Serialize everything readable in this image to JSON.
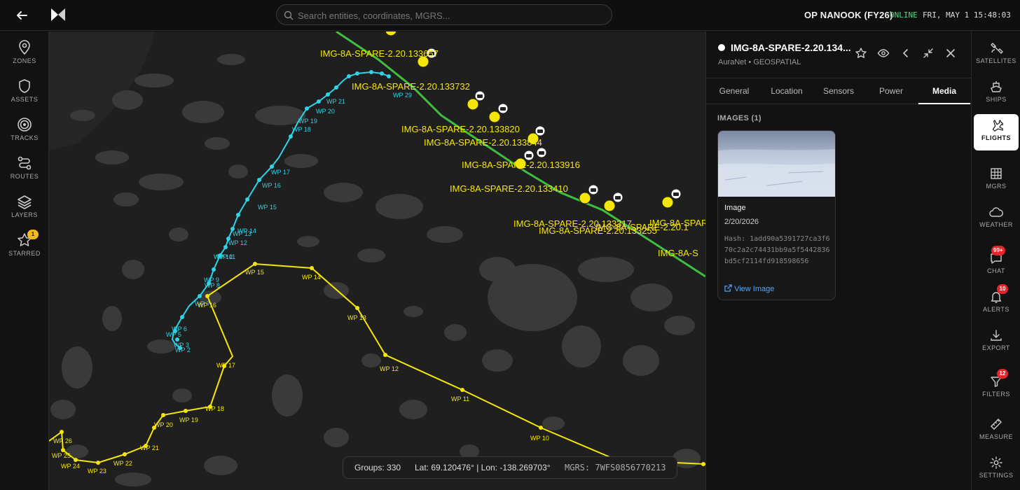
{
  "topbar": {
    "back_icon": "arrow-left-icon",
    "search_placeholder": "Search entities, coordinates, MGRS...",
    "op_name": "OP NANOOK (FY26)",
    "status": "ONLINE",
    "datetime": "FRI, MAY 1 15:48:03",
    "colors": {
      "online": "#4ade80"
    }
  },
  "leftnav": {
    "items": [
      {
        "label": "ZONES",
        "icon": "map-pin-icon"
      },
      {
        "label": "ASSETS",
        "icon": "shield-icon"
      },
      {
        "label": "TRACKS",
        "icon": "target-icon"
      },
      {
        "label": "ROUTES",
        "icon": "route-icon"
      },
      {
        "label": "LAYERS",
        "icon": "layers-icon"
      },
      {
        "label": "STARRED",
        "icon": "star-icon",
        "badge": "1"
      }
    ]
  },
  "map": {
    "markers": [
      {
        "label": "IMG-8A-SPARE-2.20.133657"
      },
      {
        "label": "IMG-8A-SPARE-2.20.133732"
      },
      {
        "label": "IMG-8A-SPARE-2.20.133820"
      },
      {
        "label": "IMG-8A-SPARE-2.20.133844"
      },
      {
        "label": "IMG-8A-SPARE-2.20.133916"
      },
      {
        "label": "IMG-8A-SPARE-2.20.133410"
      },
      {
        "label": "IMG-8A-SPARE-2.20.133317"
      },
      {
        "label": "IMG-8A-SPARE-2.20.133255"
      },
      {
        "label": "IMG-8A-SPARE-2.20.1"
      },
      {
        "label": "IMG-8A-SPARE"
      },
      {
        "label": "IMG-8A-S"
      }
    ],
    "cyan_route": [
      "WP 2",
      "WP 3",
      "WP 5",
      "WP 6",
      "WP 7",
      "WP 8",
      "WP 9",
      "WP 10",
      "WP 11",
      "WP 12",
      "WP 13",
      "WP 14",
      "WP 15",
      "WP 16",
      "WP 17",
      "WP 18",
      "WP 19",
      "WP 20",
      "WP 21",
      "WP 29"
    ],
    "yellow_route": [
      "WP 10",
      "WP 11",
      "WP 12",
      "WP 13",
      "WP 14",
      "WP 15",
      "WP 16",
      "WP 17",
      "WP 18",
      "WP 19",
      "WP 20",
      "WP 21",
      "WP 22",
      "WP 23",
      "WP 24",
      "WP 25",
      "WP 26"
    ],
    "colors": {
      "cyan_route": "#2ed3e6",
      "yellow_route": "#f5e60a",
      "track": "#3fbf3f",
      "water": "#3a3a3a",
      "land": "#1f1f1f"
    }
  },
  "bottombar": {
    "groups": "Groups: 330",
    "coords": "Lat: 69.120476° | Lon: -138.269703°",
    "mgrs": "MGRS: 7WFS0856770213"
  },
  "panel": {
    "title": "IMG-8A-SPARE-2.20.134...",
    "subtitle": "AuraNet • GEOSPATIAL",
    "tabs": [
      "General",
      "Location",
      "Sensors",
      "Power",
      "Media"
    ],
    "active_tab": "Media",
    "images_label": "IMAGES (1)",
    "image": {
      "title": "Image",
      "date": "2/20/2026",
      "hash": "Hash: 1add90a5391727ca3f670c2a2c74431bb9a5f5442836bd5cf2114fd918598656",
      "link": "View Image"
    }
  },
  "rightnav": {
    "items": [
      {
        "label": "SATELLITES",
        "icon": "satellite-icon"
      },
      {
        "label": "SHIPS",
        "icon": "ship-icon"
      },
      {
        "label": "FLIGHTS",
        "icon": "plane-icon",
        "active": true
      },
      {
        "label": "MGRS",
        "icon": "grid-icon"
      },
      {
        "label": "WEATHER",
        "icon": "cloud-icon"
      },
      {
        "label": "CHAT",
        "icon": "chat-icon",
        "badge": "99+"
      },
      {
        "label": "ALERTS",
        "icon": "bell-icon",
        "badge": "10"
      },
      {
        "label": "EXPORT",
        "icon": "download-icon"
      },
      {
        "label": "FILTERS",
        "icon": "filter-icon",
        "badge": "12"
      },
      {
        "label": "MEASURE",
        "icon": "ruler-icon"
      },
      {
        "label": "SETTINGS",
        "icon": "gear-icon"
      }
    ]
  }
}
